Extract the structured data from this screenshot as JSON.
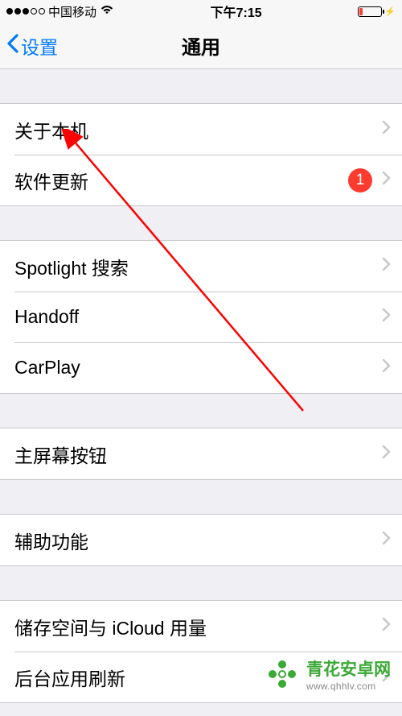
{
  "status": {
    "carrier": "中国移动",
    "time": "下午7:15"
  },
  "nav": {
    "back_label": "设置",
    "title": "通用"
  },
  "groups": [
    {
      "rows": [
        {
          "label": "关于本机",
          "badge": null
        },
        {
          "label": "软件更新",
          "badge": "1"
        }
      ]
    },
    {
      "rows": [
        {
          "label": "Spotlight 搜索",
          "badge": null
        },
        {
          "label": "Handoff",
          "badge": null
        },
        {
          "label": "CarPlay",
          "badge": null
        }
      ]
    },
    {
      "rows": [
        {
          "label": "主屏幕按钮",
          "badge": null
        }
      ]
    },
    {
      "rows": [
        {
          "label": "辅助功能",
          "badge": null
        }
      ]
    },
    {
      "rows": [
        {
          "label": "储存空间与 iCloud 用量",
          "badge": null
        },
        {
          "label": "后台应用刷新",
          "badge": null
        }
      ]
    }
  ],
  "watermark": {
    "title": "青花安卓网",
    "url": "www.qhhlv.com"
  }
}
